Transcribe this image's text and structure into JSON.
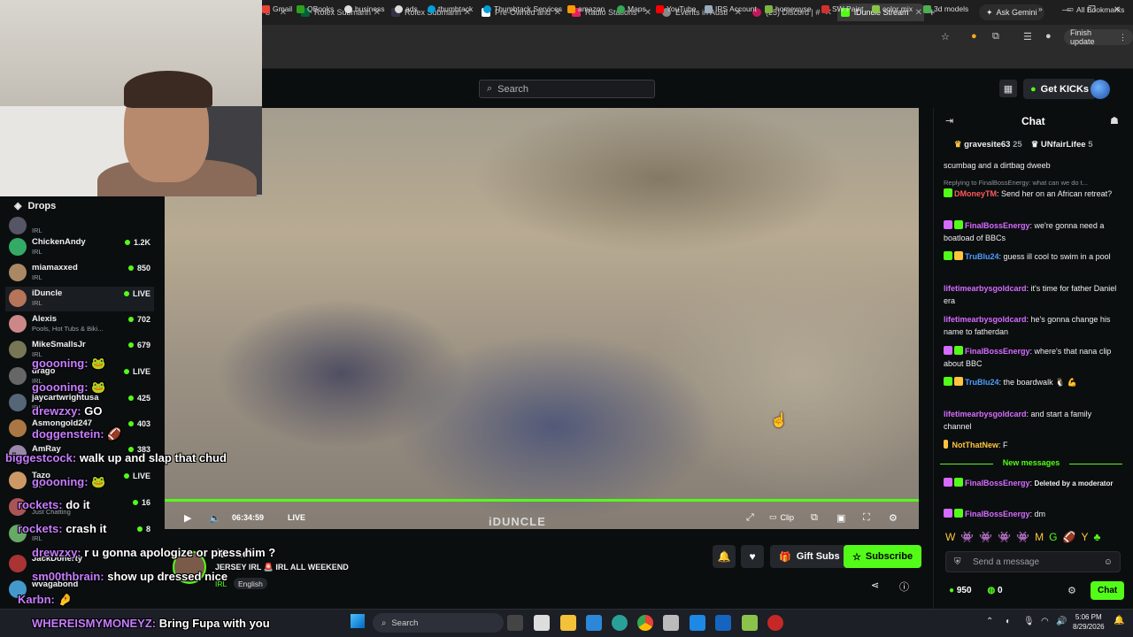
{
  "browser": {
    "tabs": [
      {
        "label": "b"
      },
      {
        "label": "Rolex Submarin"
      },
      {
        "label": "Rolex Submarin"
      },
      {
        "label": "Pre-Owned and"
      },
      {
        "label": "Radio Stations"
      },
      {
        "label": "Events in Austi"
      },
      {
        "label": "(25) Discord | #"
      },
      {
        "label": "iDuncle Stream"
      }
    ],
    "ask_gemini": "Ask Gemini",
    "finish_update": "Finish update",
    "bookmarks": [
      "Gmail",
      "QBooks",
      "business",
      "ads",
      "thumbtack",
      "Thumbtack Services",
      "amazon",
      "Maps",
      "YouTube",
      "IRS Account",
      "homewyse",
      "SW Paint",
      "color mix",
      "3d models"
    ],
    "all_bookmarks": "All Bookmarks"
  },
  "header": {
    "search_placeholder": "Search",
    "get_kicks": "Get KICKs"
  },
  "sidebar": {
    "drops_label": "Drops",
    "channels": [
      {
        "name": "",
        "category": "IRL",
        "viewers": ""
      },
      {
        "name": "ChickenAndy",
        "category": "IRL",
        "viewers": "1.2K"
      },
      {
        "name": "miamaxxed",
        "category": "IRL",
        "viewers": "850"
      },
      {
        "name": "iDuncle",
        "category": "IRL",
        "viewers": "LIVE"
      },
      {
        "name": "Alexis",
        "category": "Pools, Hot Tubs & Biki...",
        "viewers": "702"
      },
      {
        "name": "MikeSmallsJr",
        "category": "IRL",
        "viewers": "679"
      },
      {
        "name": "drago",
        "category": "IRL",
        "viewers": "LIVE"
      },
      {
        "name": "jaycartwrightusa",
        "category": "IRL",
        "viewers": "425"
      },
      {
        "name": "Asmongold247",
        "category": "IRL",
        "viewers": "403"
      },
      {
        "name": "AmRay",
        "category": "IRL",
        "viewers": "383"
      },
      {
        "name": "Tazo",
        "category": "IRL",
        "viewers": "LIVE"
      },
      {
        "name": "",
        "category": "Just Chatting",
        "viewers": "16"
      },
      {
        "name": "",
        "category": "IRL",
        "viewers": "8"
      },
      {
        "name": "JackDoherty",
        "category": "",
        "viewers": ""
      },
      {
        "name": "wvagabond",
        "category": "",
        "viewers": ""
      }
    ]
  },
  "player": {
    "time": "06:34:59",
    "live_label": "LIVE",
    "watermark": "iDUNCLE",
    "clip_label": "Clip"
  },
  "stream_info": {
    "streamer": "iDuncle",
    "title": "JERSEY IRL 🚨 IRL ALL WEEKEND",
    "category": "IRL",
    "language": "English",
    "gift_subs": "Gift Subs",
    "subscribe": "Subscribe"
  },
  "overlay_chat": [
    {
      "user": "goooning:",
      "text": "🐸"
    },
    {
      "user": "goooning:",
      "text": "🐸"
    },
    {
      "user": "drewzxy:",
      "text": "GO"
    },
    {
      "user": "doggenstein:",
      "text": "🏈"
    },
    {
      "user": "biggestcock:",
      "text": "walk up and slap that chud"
    },
    {
      "user": "goooning:",
      "text": "🐸"
    },
    {
      "user": "rockets:",
      "text": "do it"
    },
    {
      "user": "rockets:",
      "text": "crash it"
    },
    {
      "user": "drewzxy:",
      "text": "r u gonna apologize or press him ?"
    },
    {
      "user": "sm00thbrain:",
      "text": "show up dressed nice"
    },
    {
      "user": "Karbn:",
      "text": "🤌"
    },
    {
      "user": "WHEREISMYMONEYZ:",
      "text": "Bring Fupa with you"
    }
  ],
  "chat": {
    "title": "Chat",
    "gifters": [
      {
        "name": "gravesite63",
        "count": "25"
      },
      {
        "name": "UNfairLifee",
        "count": "5"
      }
    ],
    "reply_line": "Replying to FinalBossEnergy: what can we do t...",
    "messages": [
      {
        "user": "",
        "color": "#53fc18",
        "text": "scumbag and a dirtbag dweeb"
      },
      {
        "user": "DMoneyTM",
        "color": "#ff5a5a",
        "text": "Send her on an African retreat?"
      },
      {
        "user": "FinalBossEnergy",
        "color": "#d66bff",
        "text": "we're gonna need a boatload of BBCs"
      },
      {
        "user": "TruBlu24",
        "color": "#4f9dff",
        "text": "guess ill cool to swim in a pool"
      },
      {
        "user": "lifetimearbysgoldcard",
        "color": "#d66bff",
        "text": "it's time for father Daniel era"
      },
      {
        "user": "lifetimearbysgoldcard",
        "color": "#d66bff",
        "text": "he's gonna change his name to fatherdan"
      },
      {
        "user": "FinalBossEnergy",
        "color": "#d66bff",
        "text": "where's that nana clip about BBC"
      },
      {
        "user": "TruBlu24",
        "color": "#4f9dff",
        "text": "the boardwalk 🐧 💪"
      },
      {
        "user": "lifetimearbysgoldcard",
        "color": "#d66bff",
        "text": "and start a family channel"
      },
      {
        "user": "NotThatNew",
        "color": "#ffc53d",
        "text": "F"
      },
      {
        "user": "FinalBossEnergy",
        "color": "#d66bff",
        "text": "Deleted by a moderator"
      },
      {
        "user": "FinalBossEnergy",
        "color": "#d66bff",
        "text": "dm"
      }
    ],
    "new_messages": "New messages",
    "input_placeholder": "Send a message",
    "kicks_count": "950",
    "points": "0",
    "chat_button": "Chat"
  },
  "taskbar": {
    "search": "Search",
    "time": "5:06 PM",
    "date": "8/29/2026"
  }
}
